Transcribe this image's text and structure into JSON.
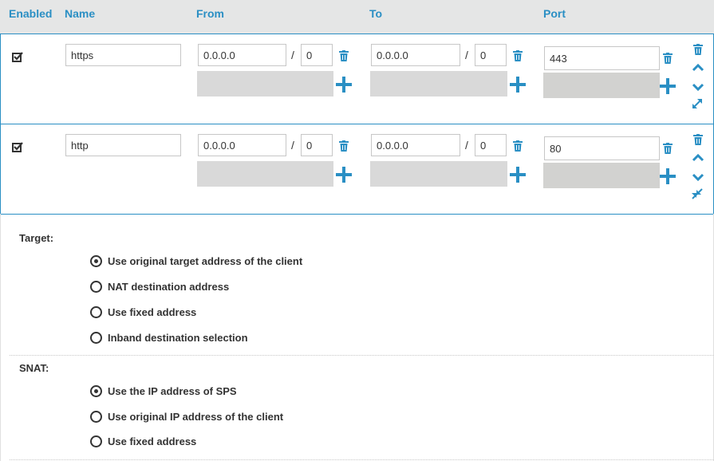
{
  "header": {
    "enabled": "Enabled",
    "name": "Name",
    "from": "From",
    "to": "To",
    "port": "Port"
  },
  "rules": [
    {
      "enabled": true,
      "name": "https",
      "from_ip": "0.0.0.0",
      "from_mask": "0",
      "to_ip": "0.0.0.0",
      "to_mask": "0",
      "port": "443",
      "resize_icon": "expand-icon"
    },
    {
      "enabled": true,
      "name": "http",
      "from_ip": "0.0.0.0",
      "from_mask": "0",
      "to_ip": "0.0.0.0",
      "to_mask": "0",
      "port": "80",
      "resize_icon": "collapse-icon"
    }
  ],
  "separator": "/",
  "target": {
    "label": "Target:",
    "options": [
      {
        "label": "Use original target address of the client",
        "selected": true
      },
      {
        "label": "NAT destination address",
        "selected": false
      },
      {
        "label": "Use fixed address",
        "selected": false
      },
      {
        "label": "Inband destination selection",
        "selected": false
      }
    ]
  },
  "snat": {
    "label": "SNAT:",
    "options": [
      {
        "label": "Use the IP address of SPS",
        "selected": true
      },
      {
        "label": "Use original IP address of the client",
        "selected": false
      },
      {
        "label": "Use fixed address",
        "selected": false
      }
    ]
  },
  "colors": {
    "accent": "#2a8fc4",
    "header_bg": "#e5e6e6",
    "empty_field": "#d9d9d9"
  }
}
